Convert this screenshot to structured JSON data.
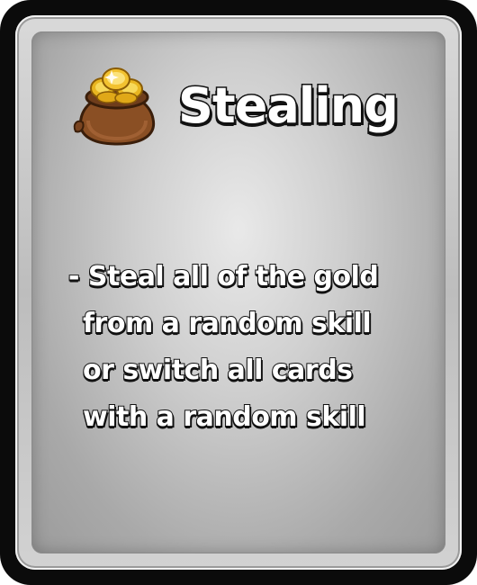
{
  "card": {
    "title": "Stealing",
    "icon": "gold-coin-bag-icon",
    "description_lines": [
      "- Steal all of the gold",
      "from a random skill",
      "or switch all cards",
      "with a random skill"
    ]
  },
  "colors": {
    "frame": "#0b0b0b",
    "bevel": "#cfcfcf",
    "panel": "#c4c4c4",
    "text": "#ffffff",
    "text_outline": "#111111",
    "coin_gold": "#f2c230",
    "bag_brown": "#8a4f24"
  }
}
